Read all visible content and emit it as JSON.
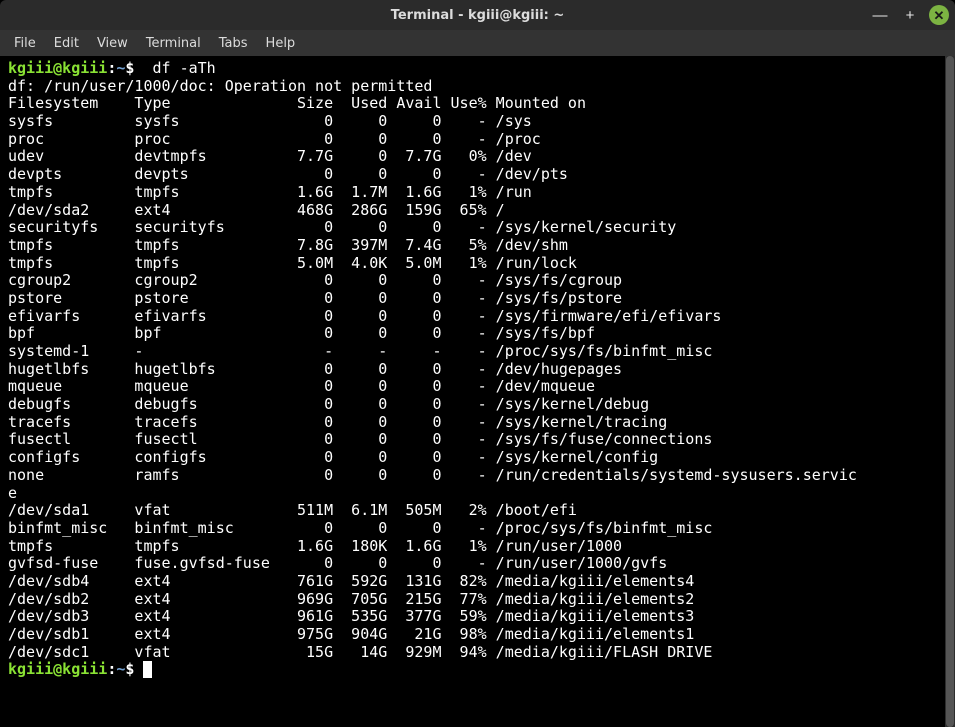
{
  "window": {
    "title": "Terminal - kgiii@kgiii: ~",
    "close_glyph": "✕",
    "minimize_glyph": "—",
    "maximize_glyph": "+"
  },
  "menubar": {
    "items": [
      "File",
      "Edit",
      "View",
      "Terminal",
      "Tabs",
      "Help"
    ]
  },
  "prompt": {
    "userhost": "kgiii@kgiii",
    "sep": ":",
    "path": "~",
    "dollar": "$"
  },
  "command": "df -aTh",
  "error_line": "df: /run/user/1000/doc: Operation not permitted",
  "columns": [
    "Filesystem",
    "Type",
    "Size",
    "Used",
    "Avail",
    "Use%",
    "Mounted on"
  ],
  "rows": [
    {
      "fs": "sysfs",
      "type": "sysfs",
      "size": "0",
      "used": "0",
      "avail": "0",
      "use": "-",
      "mount": "/sys"
    },
    {
      "fs": "proc",
      "type": "proc",
      "size": "0",
      "used": "0",
      "avail": "0",
      "use": "-",
      "mount": "/proc"
    },
    {
      "fs": "udev",
      "type": "devtmpfs",
      "size": "7.7G",
      "used": "0",
      "avail": "7.7G",
      "use": "0%",
      "mount": "/dev"
    },
    {
      "fs": "devpts",
      "type": "devpts",
      "size": "0",
      "used": "0",
      "avail": "0",
      "use": "-",
      "mount": "/dev/pts"
    },
    {
      "fs": "tmpfs",
      "type": "tmpfs",
      "size": "1.6G",
      "used": "1.7M",
      "avail": "1.6G",
      "use": "1%",
      "mount": "/run"
    },
    {
      "fs": "/dev/sda2",
      "type": "ext4",
      "size": "468G",
      "used": "286G",
      "avail": "159G",
      "use": "65%",
      "mount": "/"
    },
    {
      "fs": "securityfs",
      "type": "securityfs",
      "size": "0",
      "used": "0",
      "avail": "0",
      "use": "-",
      "mount": "/sys/kernel/security"
    },
    {
      "fs": "tmpfs",
      "type": "tmpfs",
      "size": "7.8G",
      "used": "397M",
      "avail": "7.4G",
      "use": "5%",
      "mount": "/dev/shm"
    },
    {
      "fs": "tmpfs",
      "type": "tmpfs",
      "size": "5.0M",
      "used": "4.0K",
      "avail": "5.0M",
      "use": "1%",
      "mount": "/run/lock"
    },
    {
      "fs": "cgroup2",
      "type": "cgroup2",
      "size": "0",
      "used": "0",
      "avail": "0",
      "use": "-",
      "mount": "/sys/fs/cgroup"
    },
    {
      "fs": "pstore",
      "type": "pstore",
      "size": "0",
      "used": "0",
      "avail": "0",
      "use": "-",
      "mount": "/sys/fs/pstore"
    },
    {
      "fs": "efivarfs",
      "type": "efivarfs",
      "size": "0",
      "used": "0",
      "avail": "0",
      "use": "-",
      "mount": "/sys/firmware/efi/efivars"
    },
    {
      "fs": "bpf",
      "type": "bpf",
      "size": "0",
      "used": "0",
      "avail": "0",
      "use": "-",
      "mount": "/sys/fs/bpf"
    },
    {
      "fs": "systemd-1",
      "type": "-",
      "size": "-",
      "used": "-",
      "avail": "-",
      "use": "-",
      "mount": "/proc/sys/fs/binfmt_misc"
    },
    {
      "fs": "hugetlbfs",
      "type": "hugetlbfs",
      "size": "0",
      "used": "0",
      "avail": "0",
      "use": "-",
      "mount": "/dev/hugepages"
    },
    {
      "fs": "mqueue",
      "type": "mqueue",
      "size": "0",
      "used": "0",
      "avail": "0",
      "use": "-",
      "mount": "/dev/mqueue"
    },
    {
      "fs": "debugfs",
      "type": "debugfs",
      "size": "0",
      "used": "0",
      "avail": "0",
      "use": "-",
      "mount": "/sys/kernel/debug"
    },
    {
      "fs": "tracefs",
      "type": "tracefs",
      "size": "0",
      "used": "0",
      "avail": "0",
      "use": "-",
      "mount": "/sys/kernel/tracing"
    },
    {
      "fs": "fusectl",
      "type": "fusectl",
      "size": "0",
      "used": "0",
      "avail": "0",
      "use": "-",
      "mount": "/sys/fs/fuse/connections"
    },
    {
      "fs": "configfs",
      "type": "configfs",
      "size": "0",
      "used": "0",
      "avail": "0",
      "use": "-",
      "mount": "/sys/kernel/config"
    },
    {
      "fs": "none",
      "type": "ramfs",
      "size": "0",
      "used": "0",
      "avail": "0",
      "use": "-",
      "mount": "/run/credentials/systemd-sysusers.servic",
      "overflow": "e"
    },
    {
      "fs": "/dev/sda1",
      "type": "vfat",
      "size": "511M",
      "used": "6.1M",
      "avail": "505M",
      "use": "2%",
      "mount": "/boot/efi"
    },
    {
      "fs": "binfmt_misc",
      "type": "binfmt_misc",
      "size": "0",
      "used": "0",
      "avail": "0",
      "use": "-",
      "mount": "/proc/sys/fs/binfmt_misc"
    },
    {
      "fs": "tmpfs",
      "type": "tmpfs",
      "size": "1.6G",
      "used": "180K",
      "avail": "1.6G",
      "use": "1%",
      "mount": "/run/user/1000"
    },
    {
      "fs": "gvfsd-fuse",
      "type": "fuse.gvfsd-fuse",
      "size": "0",
      "used": "0",
      "avail": "0",
      "use": "-",
      "mount": "/run/user/1000/gvfs"
    },
    {
      "fs": "/dev/sdb4",
      "type": "ext4",
      "size": "761G",
      "used": "592G",
      "avail": "131G",
      "use": "82%",
      "mount": "/media/kgiii/elements4"
    },
    {
      "fs": "/dev/sdb2",
      "type": "ext4",
      "size": "969G",
      "used": "705G",
      "avail": "215G",
      "use": "77%",
      "mount": "/media/kgiii/elements2"
    },
    {
      "fs": "/dev/sdb3",
      "type": "ext4",
      "size": "961G",
      "used": "535G",
      "avail": "377G",
      "use": "59%",
      "mount": "/media/kgiii/elements3"
    },
    {
      "fs": "/dev/sdb1",
      "type": "ext4",
      "size": "975G",
      "used": "904G",
      "avail": "21G",
      "use": "98%",
      "mount": "/media/kgiii/elements1"
    },
    {
      "fs": "/dev/sdc1",
      "type": "vfat",
      "size": "15G",
      "used": "14G",
      "avail": "929M",
      "use": "94%",
      "mount": "/media/kgiii/FLASH DRIVE"
    }
  ]
}
